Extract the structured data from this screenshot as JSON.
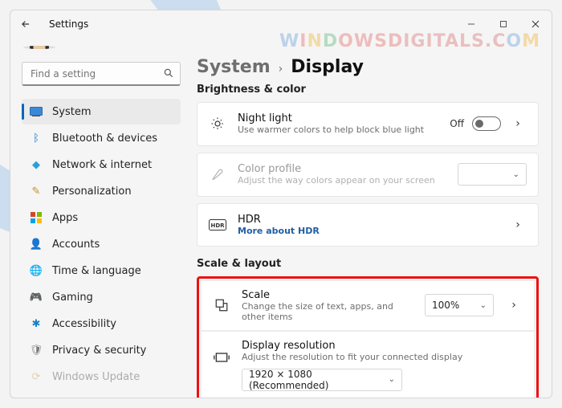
{
  "window": {
    "title": "Settings"
  },
  "watermark": "WINDOWSDIGITALS.COM",
  "search": {
    "placeholder": "Find a setting"
  },
  "nav": [
    {
      "label": "System",
      "icon": "system",
      "active": true
    },
    {
      "label": "Bluetooth & devices",
      "icon": "bluetooth"
    },
    {
      "label": "Network & internet",
      "icon": "network"
    },
    {
      "label": "Personalization",
      "icon": "personalization"
    },
    {
      "label": "Apps",
      "icon": "apps"
    },
    {
      "label": "Accounts",
      "icon": "accounts"
    },
    {
      "label": "Time & language",
      "icon": "time"
    },
    {
      "label": "Gaming",
      "icon": "gaming"
    },
    {
      "label": "Accessibility",
      "icon": "accessibility"
    },
    {
      "label": "Privacy & security",
      "icon": "privacy"
    },
    {
      "label": "Windows Update",
      "icon": "update"
    }
  ],
  "breadcrumb": {
    "seg1": "System",
    "seg2": "Display"
  },
  "sections": {
    "brightness_title": "Brightness & color",
    "scale_title": "Scale & layout"
  },
  "night_light": {
    "title": "Night light",
    "subtitle": "Use warmer colors to help block blue light",
    "state_label": "Off",
    "on": false
  },
  "color_profile": {
    "title": "Color profile",
    "subtitle": "Adjust the way colors appear on your screen",
    "value": ""
  },
  "hdr": {
    "title": "HDR",
    "link": "More about HDR"
  },
  "scale": {
    "title": "Scale",
    "subtitle": "Change the size of text, apps, and other items",
    "value": "100%"
  },
  "resolution": {
    "title": "Display resolution",
    "subtitle": "Adjust the resolution to fit your connected display",
    "value": "1920 × 1080 (Recommended)"
  }
}
